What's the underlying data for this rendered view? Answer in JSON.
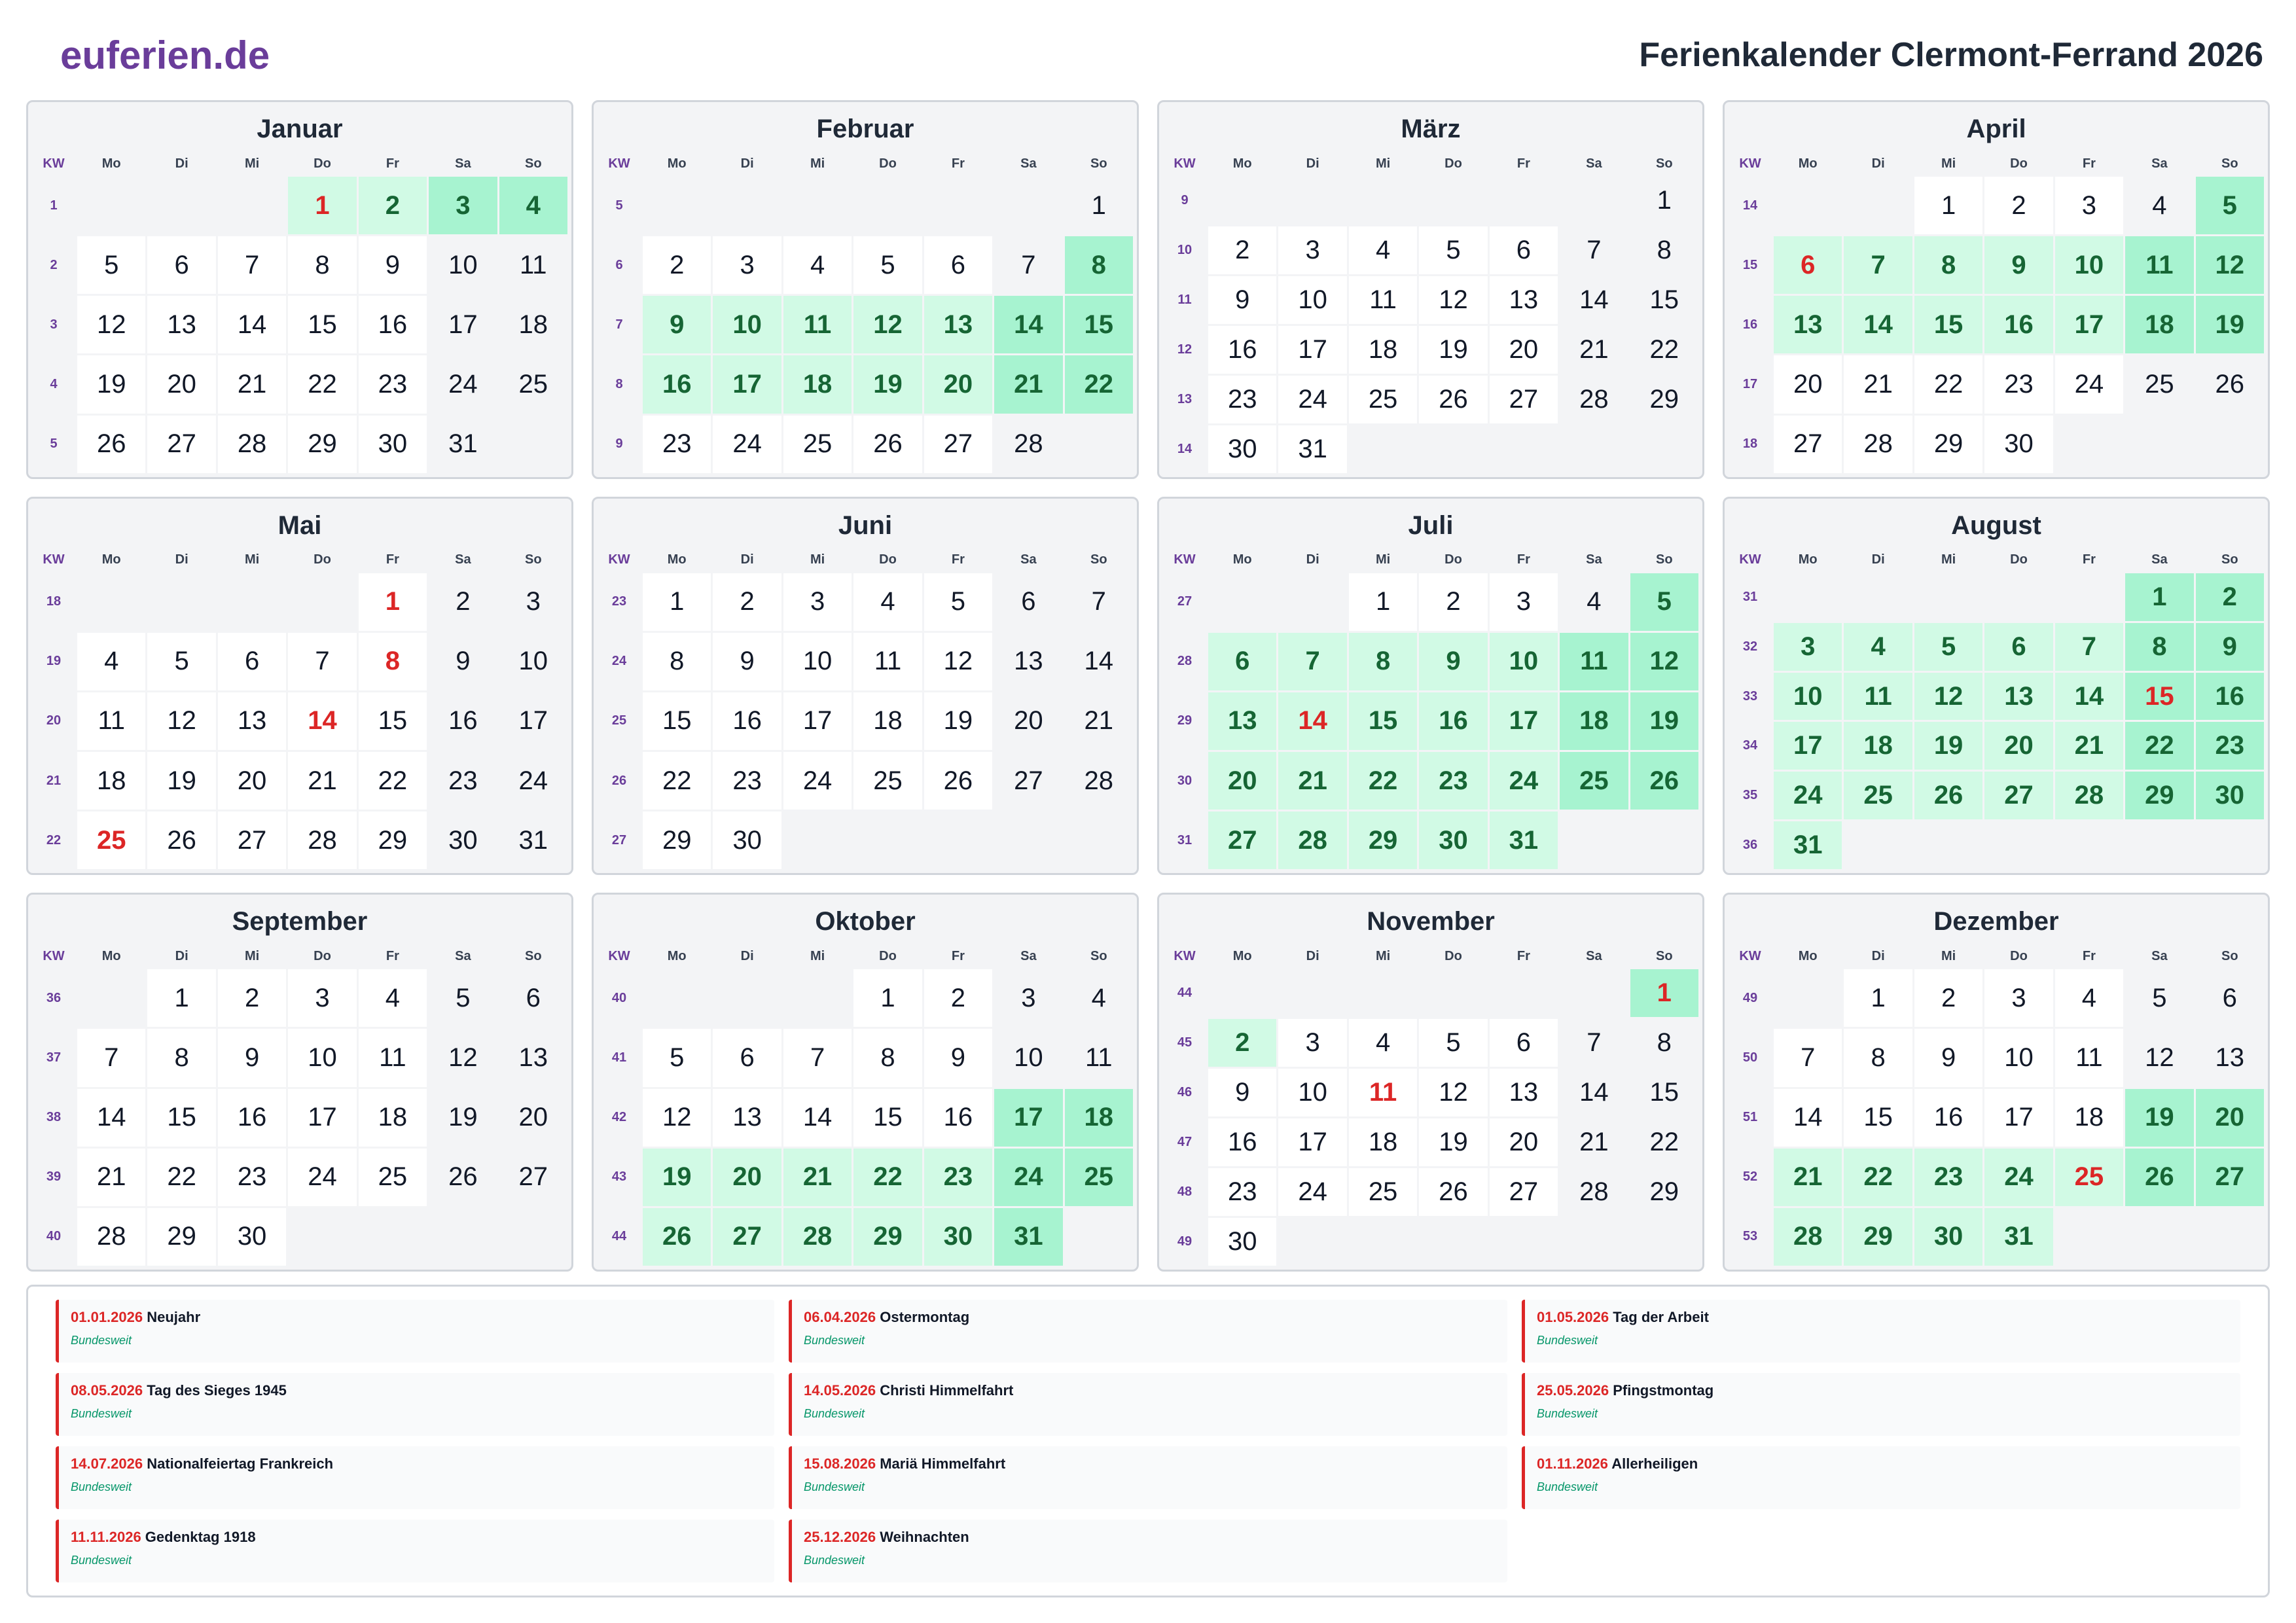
{
  "header": {
    "brand": "euferien.de",
    "title": "Ferienkalender Clermont-Ferrand 2026"
  },
  "weekday_labels": [
    "KW",
    "Mo",
    "Di",
    "Mi",
    "Do",
    "Fr",
    "Sa",
    "So"
  ],
  "months": [
    {
      "name": "Januar",
      "offset": 3,
      "days": 31,
      "kw": [
        1,
        2,
        3,
        4,
        5
      ],
      "vacation": [
        1,
        2,
        3,
        4
      ],
      "holidays": [
        1
      ]
    },
    {
      "name": "Februar",
      "offset": 6,
      "days": 28,
      "kw": [
        5,
        6,
        7,
        8,
        9
      ],
      "vacation": [
        8,
        9,
        10,
        11,
        12,
        13,
        14,
        15,
        16,
        17,
        18,
        19,
        20,
        21,
        22
      ],
      "holidays": []
    },
    {
      "name": "März",
      "offset": 6,
      "days": 31,
      "kw": [
        9,
        10,
        11,
        12,
        13,
        14
      ],
      "vacation": [],
      "holidays": []
    },
    {
      "name": "April",
      "offset": 2,
      "days": 30,
      "kw": [
        14,
        15,
        16,
        17,
        18
      ],
      "vacation": [
        5,
        6,
        7,
        8,
        9,
        10,
        11,
        12,
        13,
        14,
        15,
        16,
        17,
        18,
        19
      ],
      "holidays": [
        6
      ]
    },
    {
      "name": "Mai",
      "offset": 4,
      "days": 31,
      "kw": [
        18,
        19,
        20,
        21,
        22
      ],
      "vacation": [],
      "holidays": [
        1,
        8,
        14,
        25
      ]
    },
    {
      "name": "Juni",
      "offset": 0,
      "days": 30,
      "kw": [
        23,
        24,
        25,
        26,
        27
      ],
      "vacation": [],
      "holidays": []
    },
    {
      "name": "Juli",
      "offset": 2,
      "days": 31,
      "kw": [
        27,
        28,
        29,
        30,
        31
      ],
      "vacation": [
        5,
        6,
        7,
        8,
        9,
        10,
        11,
        12,
        13,
        14,
        15,
        16,
        17,
        18,
        19,
        20,
        21,
        22,
        23,
        24,
        25,
        26,
        27,
        28,
        29,
        30,
        31
      ],
      "holidays": [
        14
      ]
    },
    {
      "name": "August",
      "offset": 5,
      "days": 31,
      "kw": [
        31,
        32,
        33,
        34,
        35,
        36
      ],
      "vacation": [
        1,
        2,
        3,
        4,
        5,
        6,
        7,
        8,
        9,
        10,
        11,
        12,
        13,
        14,
        15,
        16,
        17,
        18,
        19,
        20,
        21,
        22,
        23,
        24,
        25,
        26,
        27,
        28,
        29,
        30,
        31
      ],
      "holidays": [
        15
      ]
    },
    {
      "name": "September",
      "offset": 1,
      "days": 30,
      "kw": [
        36,
        37,
        38,
        39,
        40
      ],
      "vacation": [],
      "holidays": []
    },
    {
      "name": "Oktober",
      "offset": 3,
      "days": 31,
      "kw": [
        40,
        41,
        42,
        43,
        44
      ],
      "vacation": [
        17,
        18,
        19,
        20,
        21,
        22,
        23,
        24,
        25,
        26,
        27,
        28,
        29,
        30,
        31
      ],
      "holidays": []
    },
    {
      "name": "November",
      "offset": 6,
      "days": 30,
      "kw": [
        44,
        45,
        46,
        47,
        48,
        49
      ],
      "vacation": [
        1,
        2
      ],
      "holidays": [
        1,
        11
      ]
    },
    {
      "name": "Dezember",
      "offset": 1,
      "days": 31,
      "kw": [
        49,
        50,
        51,
        52,
        53
      ],
      "vacation": [
        19,
        20,
        21,
        22,
        23,
        24,
        25,
        26,
        27,
        28,
        29,
        30,
        31
      ],
      "holidays": [
        25
      ]
    }
  ],
  "holidays": [
    {
      "date": "01.01.2026",
      "name": "Neujahr",
      "region": "Bundesweit"
    },
    {
      "date": "06.04.2026",
      "name": "Ostermontag",
      "region": "Bundesweit"
    },
    {
      "date": "01.05.2026",
      "name": "Tag der Arbeit",
      "region": "Bundesweit"
    },
    {
      "date": "08.05.2026",
      "name": "Tag des Sieges 1945",
      "region": "Bundesweit"
    },
    {
      "date": "14.05.2026",
      "name": "Christi Himmelfahrt",
      "region": "Bundesweit"
    },
    {
      "date": "25.05.2026",
      "name": "Pfingstmontag",
      "region": "Bundesweit"
    },
    {
      "date": "14.07.2026",
      "name": "Nationalfeiertag Frankreich",
      "region": "Bundesweit"
    },
    {
      "date": "15.08.2026",
      "name": "Mariä Himmelfahrt",
      "region": "Bundesweit"
    },
    {
      "date": "01.11.2026",
      "name": "Allerheiligen",
      "region": "Bundesweit"
    },
    {
      "date": "11.11.2026",
      "name": "Gedenktag 1918",
      "region": "Bundesweit"
    },
    {
      "date": "25.12.2026",
      "name": "Weihnachten",
      "region": "Bundesweit"
    }
  ],
  "colors": {
    "brand": "#6a3d9a",
    "vacation": "#d1fae5",
    "vacation_weekend": "#a7f3d0",
    "holiday": "#dc2626",
    "region": "#059669"
  }
}
